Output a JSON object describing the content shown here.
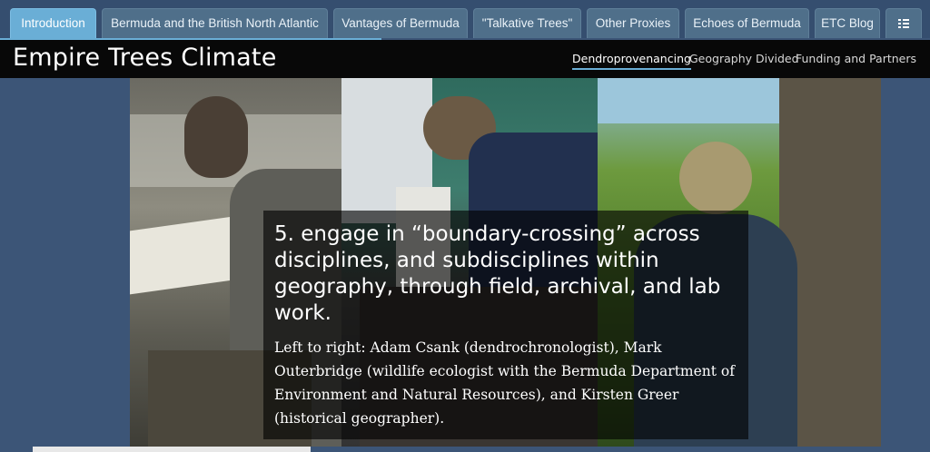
{
  "tabs": [
    {
      "label": "Introduction",
      "active": true
    },
    {
      "label": "Bermuda and the British North Atlantic",
      "active": false
    },
    {
      "label": "Vantages of Bermuda",
      "active": false
    },
    {
      "label": "\"Talkative Trees\"",
      "active": false
    },
    {
      "label": "Other Proxies",
      "active": false
    },
    {
      "label": "Echoes of Bermuda",
      "active": false
    },
    {
      "label": "ETC Blog",
      "active": false
    }
  ],
  "tab_menu_icon": "list-icon",
  "header": {
    "title": "Empire Trees Climate",
    "subnav": [
      {
        "label": "Dendroprovenancing",
        "active": true
      },
      {
        "label": "Geography Divided",
        "active": false
      },
      {
        "label": "Funding and Partners",
        "active": false
      }
    ]
  },
  "hero": {
    "heading": "5. engage in “boundary-crossing” across disciplines, and subdisciplines within geography, through field, archival, and lab work.",
    "caption": "Left to right: Adam Csank (dendrochronologist), Mark Outerbridge (wildlife ecologist with the Bermuda Department of Environment and Natural Resources), and Kirsten Greer (historical geographer)."
  },
  "colors": {
    "page_bg": "#3c5577",
    "tab_bg": "#4f6f8a",
    "tab_active": "#6aaed6",
    "header_bg": "#080808",
    "accent": "#6aaed6"
  }
}
